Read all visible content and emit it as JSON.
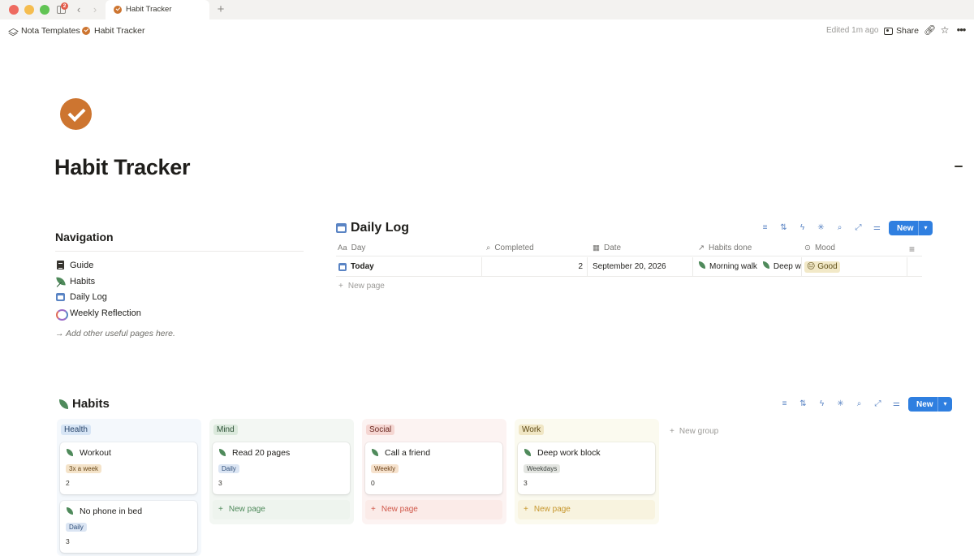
{
  "window": {
    "tab_title": "Habit Tracker",
    "badge_count": "2",
    "icons": [
      "sidebar-icon",
      "back-arrow-icon",
      "forward-arrow-icon",
      "plus-icon"
    ]
  },
  "topbar": {
    "breadcrumb_workspace": "Nota Templates",
    "breadcrumb_page": "Habit Tracker",
    "edited": "Edited 1m ago",
    "share_label": "Share",
    "icons": [
      "link-icon",
      "star-icon",
      "more-icon"
    ]
  },
  "page": {
    "title": "Habit Tracker",
    "accent_color": "#cd7530"
  },
  "navigation": {
    "heading": "Navigation",
    "items": [
      {
        "label": "Guide",
        "icon": "document-icon"
      },
      {
        "label": "Habits",
        "icon": "leaf-icon"
      },
      {
        "label": "Daily Log",
        "icon": "calendar-icon"
      },
      {
        "label": "Weekly Reflection",
        "icon": "cycle-icon"
      }
    ],
    "note": "→ Add other useful pages here."
  },
  "daily_log": {
    "title": "Daily Log",
    "new_button": "New",
    "columns": [
      {
        "label": "Day",
        "icon": "Aa"
      },
      {
        "label": "Completed",
        "icon": "search-icon"
      },
      {
        "label": "Date",
        "icon": "calendar-icon"
      },
      {
        "label": "Habits done",
        "icon": "relation-arrow-icon"
      },
      {
        "label": "Mood",
        "icon": "select-icon"
      }
    ],
    "rows": [
      {
        "day": "Today",
        "completed": "2",
        "date": "September 20, 2026",
        "habits": [
          "Morning walk",
          "Deep w"
        ],
        "mood": "😐 Good"
      }
    ],
    "new_page": "New page"
  },
  "habits": {
    "title": "Habits",
    "new_button": "New",
    "groups": [
      {
        "name": "Health",
        "cards": [
          {
            "name": "Workout",
            "frequency": "3x a week",
            "count": "2"
          },
          {
            "name": "No phone in bed",
            "frequency": "Daily",
            "count": "3"
          }
        ]
      },
      {
        "name": "Mind",
        "cards": [
          {
            "name": "Read 20 pages",
            "frequency": "Daily",
            "count": "3"
          }
        ],
        "new_page": "New page"
      },
      {
        "name": "Social",
        "cards": [
          {
            "name": "Call a friend",
            "frequency": "Weekly",
            "count": "0"
          }
        ],
        "new_page": "New page"
      },
      {
        "name": "Work",
        "cards": [
          {
            "name": "Deep work block",
            "frequency": "Weekdays",
            "count": "3"
          }
        ],
        "new_page": "New page"
      }
    ],
    "new_group": "New group"
  },
  "colors": {
    "primary_button": "#2f7fe0",
    "health": "#d7e5f5",
    "mind": "#dbe9dc",
    "social": "#f5d6d2",
    "work": "#f0e6c4"
  }
}
